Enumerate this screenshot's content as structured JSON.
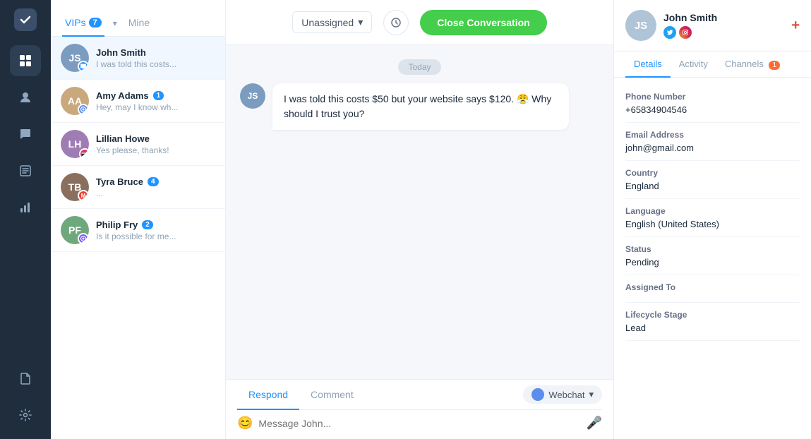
{
  "nav": {
    "logo_symbol": "✓",
    "icons": [
      {
        "name": "dashboard-icon",
        "symbol": "⊞",
        "active": false
      },
      {
        "name": "contacts-icon",
        "symbol": "👤",
        "active": false
      },
      {
        "name": "conversations-icon",
        "symbol": "💬",
        "active": true
      },
      {
        "name": "reports-icon",
        "symbol": "📋",
        "active": false
      },
      {
        "name": "analytics-icon",
        "symbol": "📊",
        "active": false
      },
      {
        "name": "documents-icon",
        "symbol": "📄",
        "active": false
      },
      {
        "name": "settings-icon",
        "symbol": "⚙",
        "active": false
      }
    ]
  },
  "conversation_list": {
    "tabs": [
      {
        "label": "VIPs",
        "badge": "7",
        "active": true
      },
      {
        "label": "Mine",
        "badge": null,
        "active": false
      }
    ],
    "items": [
      {
        "id": 1,
        "name": "John Smith",
        "preview": "I was told this costs...",
        "avatar_color": "#7c9cbf",
        "avatar_initials": "JS",
        "channel": "chat",
        "channel_color": "#1f93ff",
        "unread": null,
        "active": true,
        "has_green_dot": false
      },
      {
        "id": 2,
        "name": "Amy Adams",
        "preview": "Hey, may I know wh...",
        "avatar_color": "#c9a87c",
        "avatar_initials": "AA",
        "channel": "webchat",
        "channel_color": "#5b8dee",
        "unread": "1",
        "active": false,
        "has_green_dot": false
      },
      {
        "id": 3,
        "name": "Lillian Howe",
        "preview": "Yes please, thanks!",
        "avatar_color": "#a07cb5",
        "avatar_initials": "LH",
        "channel": "instagram",
        "channel_color": "#e1306c",
        "unread": null,
        "active": false,
        "has_green_dot": true
      },
      {
        "id": 4,
        "name": "Tyra Bruce",
        "preview": "...",
        "avatar_color": "#8b6f5e",
        "avatar_initials": "TB",
        "channel": "gmail",
        "channel_color": "#ea4335",
        "unread": "4",
        "active": false,
        "has_green_dot": false
      },
      {
        "id": 5,
        "name": "Philip Fry",
        "preview": "Is it possible for me...",
        "avatar_color": "#6fa87c",
        "avatar_initials": "PF",
        "channel": "webchat2",
        "channel_color": "#7c4dff",
        "unread": "2",
        "active": false,
        "has_green_dot": false
      }
    ]
  },
  "chat": {
    "unassigned_label": "Unassigned",
    "close_btn_label": "Close Conversation",
    "date_divider": "Today",
    "message_text": "I was told this costs $50 but your website says $120. 😤 Why should I trust you?",
    "respond_tab": "Respond",
    "comment_tab": "Comment",
    "webchat_label": "Webchat",
    "message_placeholder": "Message John..."
  },
  "right_panel": {
    "user_name": "John Smith",
    "plus_icon": "+",
    "tabs": [
      {
        "label": "Details",
        "active": true
      },
      {
        "label": "Activity",
        "active": false
      },
      {
        "label": "Channels",
        "active": false,
        "badge": "1"
      }
    ],
    "fields": [
      {
        "label": "Phone Number",
        "value": "+65834904546"
      },
      {
        "label": "Email Address",
        "value": "john@gmail.com"
      },
      {
        "label": "Country",
        "value": "England"
      },
      {
        "label": "Language",
        "value": "English (United States)"
      },
      {
        "label": "Status",
        "value": "Pending"
      },
      {
        "label": "Assigned To",
        "value": ""
      },
      {
        "label": "Lifecycle Stage",
        "value": "Lead"
      }
    ]
  }
}
